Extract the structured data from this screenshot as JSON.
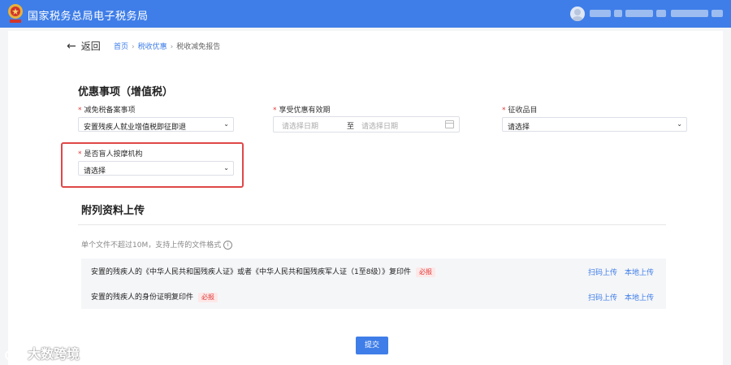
{
  "header": {
    "app_title": "国家税务总局电子税务局",
    "emblem_icon": "tax-emblem-icon",
    "avatar_icon": "user-avatar-icon",
    "brand_color": "#3f7ee8"
  },
  "nav": {
    "back_label": "返回",
    "breadcrumb": [
      "首页",
      "税收优惠",
      "税收减免报告"
    ]
  },
  "form": {
    "section_title": "优惠事项（增值税）",
    "fields": {
      "filing_item": {
        "label": "减免税备案事项",
        "value": "安置残疾人就业增值税即征即退"
      },
      "valid_period": {
        "label": "享受优惠有效期",
        "start_placeholder": "请选择日期",
        "separator": "至",
        "end_placeholder": "请选择日期"
      },
      "collection_item": {
        "label": "征收品目",
        "value": "请选择"
      },
      "blind_massage": {
        "label": "是否盲人按摩机构",
        "value": "请选择"
      }
    }
  },
  "attachments": {
    "title": "附列资料上传",
    "hint": "单个文件不超过10M，支持上传的文件格式",
    "rows": [
      {
        "name": "安置的残疾人的《中华人民共和国残疾人证》或者《中华人民共和国残疾军人证（1至8级）》复印件",
        "tag": "必报",
        "scan_label": "扫码上传",
        "local_label": "本地上传"
      },
      {
        "name": "安置的残疾人的身份证明复印件",
        "tag": "必报",
        "scan_label": "扫码上传",
        "local_label": "本地上传"
      }
    ]
  },
  "submit_label": "提交",
  "watermark": "大数跨境"
}
